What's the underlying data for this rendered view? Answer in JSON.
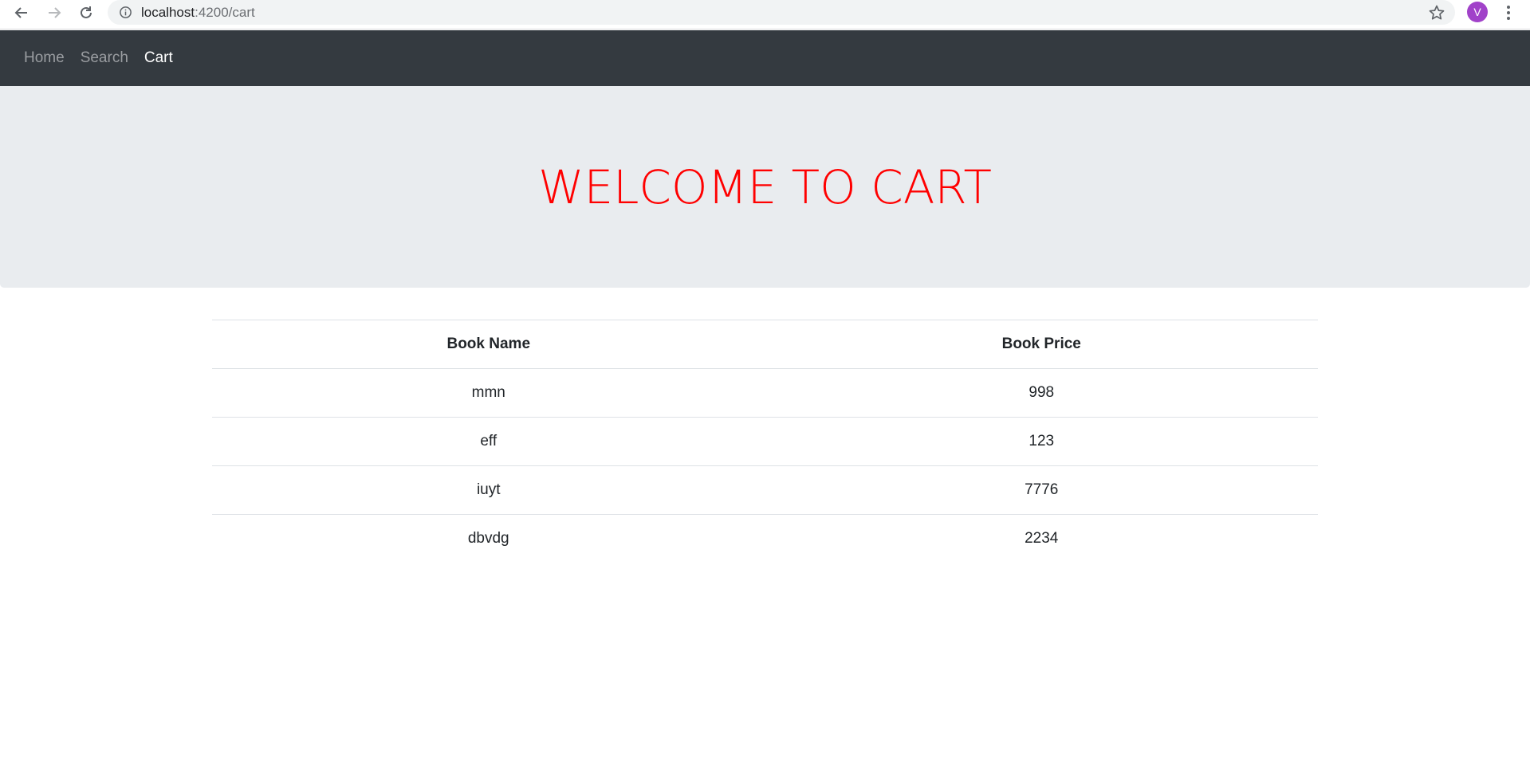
{
  "browser": {
    "url_host": "localhost",
    "url_path": ":4200/cart",
    "avatar_letter": "V",
    "icons": [
      "back-icon",
      "forward-icon",
      "reload-icon",
      "info-icon",
      "star-icon",
      "menu-dots-icon"
    ]
  },
  "navbar": {
    "links": [
      {
        "label": "Home",
        "active": false
      },
      {
        "label": "Search",
        "active": false
      },
      {
        "label": "Cart",
        "active": true
      }
    ],
    "background": "#343a40"
  },
  "jumbotron": {
    "title": "WELCOME TO CART",
    "title_color": "#ff0000"
  },
  "table": {
    "headers": [
      "Book Name",
      "Book Price"
    ],
    "rows": [
      [
        "mmn",
        "998"
      ],
      [
        "eff",
        "123"
      ],
      [
        "iuyt",
        "7776"
      ],
      [
        "dbvdg",
        "2234"
      ]
    ]
  }
}
